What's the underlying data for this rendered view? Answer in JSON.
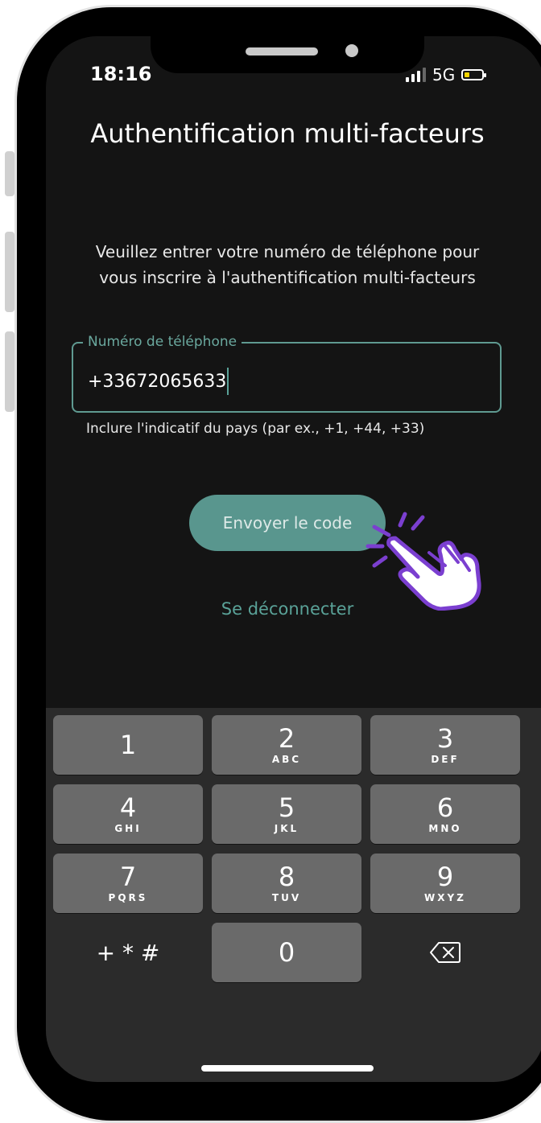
{
  "status_bar": {
    "time": "18:16",
    "network": "5G"
  },
  "title": "Authentification multi-facteurs",
  "instructions": "Veuillez entrer votre numéro de téléphone pour vous inscrire à l'authentification multi-facteurs",
  "phone_field": {
    "label": "Numéro de téléphone",
    "value": "+33672065633"
  },
  "helper_text": "Inclure l'indicatif du pays (par ex., +1, +44, +33)",
  "send_button": "Envoyer le code",
  "logout_link": "Se déconnecter",
  "keypad": {
    "k1": {
      "num": "1",
      "letters": ""
    },
    "k2": {
      "num": "2",
      "letters": "ABC"
    },
    "k3": {
      "num": "3",
      "letters": "DEF"
    },
    "k4": {
      "num": "4",
      "letters": "GHI"
    },
    "k5": {
      "num": "5",
      "letters": "JKL"
    },
    "k6": {
      "num": "6",
      "letters": "MNO"
    },
    "k7": {
      "num": "7",
      "letters": "PQRS"
    },
    "k8": {
      "num": "8",
      "letters": "TUV"
    },
    "k9": {
      "num": "9",
      "letters": "WXYZ"
    },
    "k0": {
      "num": "0"
    },
    "symbols": "+ * #"
  },
  "colors": {
    "accent": "#59968e",
    "screen_bg": "#141414",
    "hand_outline": "#7b3fd0",
    "battery": "#f2d400"
  },
  "icons": [
    "signal-icon",
    "battery-icon",
    "pointing-hand-icon",
    "backspace-icon"
  ]
}
